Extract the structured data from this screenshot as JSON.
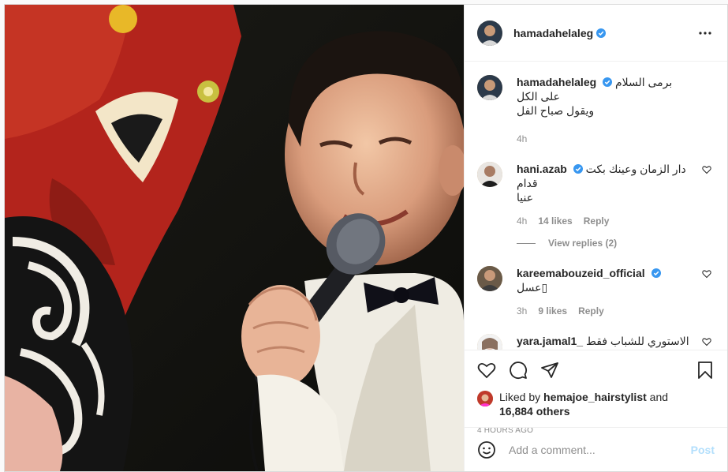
{
  "post": {
    "author": "hamadahelaleg",
    "caption_line1": "برمى السلام على الكل",
    "caption_line2": "ويقول صباح الفل",
    "caption_time": "4h"
  },
  "comments": [
    {
      "username": "hani.azab",
      "text_line1": "دار الزمان وعينك بكت قدام",
      "text_line2": "عنيا",
      "time": "4h",
      "likes": "14 likes",
      "reply": "Reply",
      "view_replies": "View replies (2)"
    },
    {
      "username": "kareemabouzeid_official",
      "text_line1": "عسل",
      "time": "3h",
      "likes": "9 likes",
      "reply": "Reply"
    },
    {
      "username": "yara.jamal1_",
      "text_line1": "الاستوري للشباب فقط",
      "text_line2": "",
      "time": "",
      "likes": "",
      "reply": ""
    }
  ],
  "likes": {
    "prefix": "Liked by",
    "first_user": "hemajoe_hairstylist",
    "connector": "and",
    "others": "16,884 others"
  },
  "timestamp": "4 HOURS AGO",
  "add_comment": {
    "placeholder": "Add a comment...",
    "post_label": "Post"
  },
  "colors": {
    "verified": "#3897f0",
    "post_disabled": "#b2dffc",
    "muted": "#8e8e8e"
  }
}
